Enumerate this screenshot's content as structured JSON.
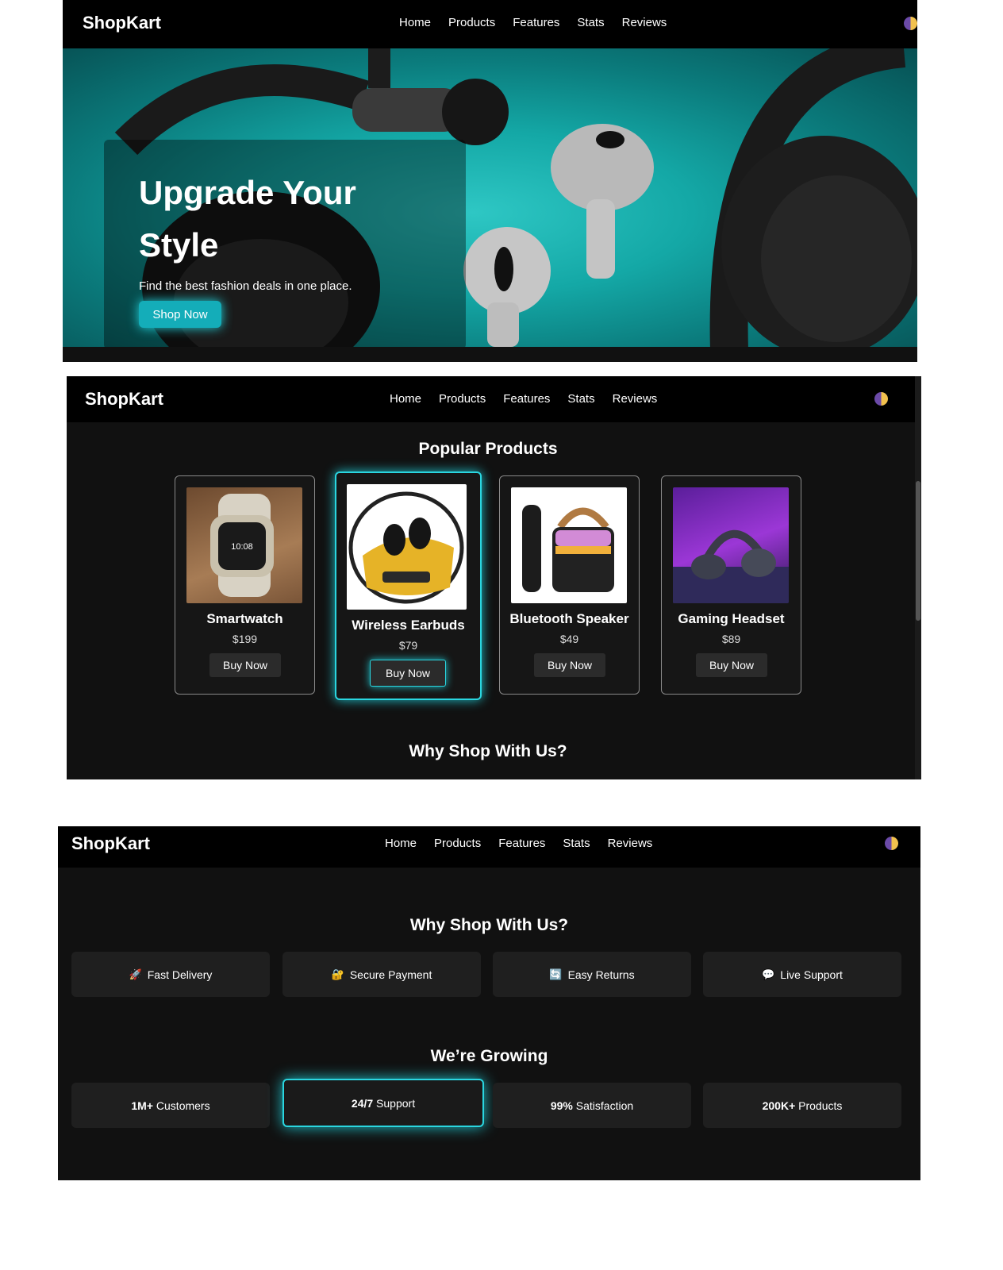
{
  "brand": "ShopKart",
  "nav": [
    "Home",
    "Products",
    "Features",
    "Stats",
    "Reviews"
  ],
  "hero": {
    "title": "Upgrade Your Style",
    "subtitle": "Find the best fashion deals in one place.",
    "cta": "Shop Now"
  },
  "products_section": {
    "title": "Popular Products",
    "next_title": "Why Shop With Us?",
    "items": [
      {
        "name": "Smartwatch",
        "price": "$199",
        "button": "Buy Now"
      },
      {
        "name": "Wireless Earbuds",
        "price": "$79",
        "button": "Buy Now"
      },
      {
        "name": "Bluetooth Speaker",
        "price": "$49",
        "button": "Buy Now"
      },
      {
        "name": "Gaming Headset",
        "price": "$89",
        "button": "Buy Now"
      }
    ]
  },
  "features": {
    "title": "Why Shop With Us?",
    "items": [
      {
        "emoji": "🚀",
        "label": "Fast Delivery"
      },
      {
        "emoji": "🔐",
        "label": "Secure Payment"
      },
      {
        "emoji": "🔄",
        "label": "Easy Returns"
      },
      {
        "emoji": "💬",
        "label": "Live Support"
      }
    ]
  },
  "stats": {
    "title": "We’re Growing",
    "items": [
      {
        "value": "1M+",
        "label": "Customers"
      },
      {
        "value": "24/7",
        "label": "Support"
      },
      {
        "value": "99%",
        "label": "Satisfaction"
      },
      {
        "value": "200K+",
        "label": "Products"
      }
    ]
  },
  "colors": {
    "accent": "#14adb9",
    "glow": "#2ad6e0",
    "background": "#111111",
    "navbar": "#000000"
  }
}
